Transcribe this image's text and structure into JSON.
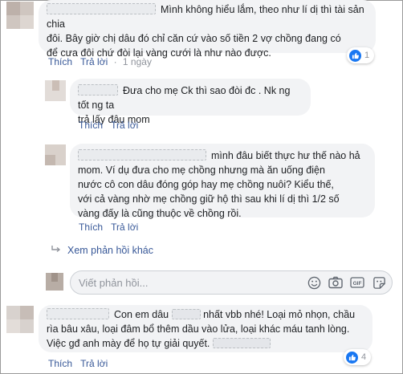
{
  "comments": [
    {
      "text_lines": [
        "Mình không hiểu lắm, theo như lí dị thì tài sản chia",
        "đôi. Bây giờ chị dâu đó chỉ căn cứ vào số tiền 2 vợ chồng đang có",
        "để cưa đôi chứ đòi lại vàng cưới là như nào được."
      ],
      "like_label": "Thích",
      "reply_label": "Trả lời",
      "time": "1 ngày",
      "reaction_count": "1"
    }
  ],
  "replies": [
    {
      "text_lines": [
        "Đưa cho mẹ Ck thì sao đòi đc . Nk ng tốt ng ta",
        "trả lấy đâu mom"
      ],
      "like_label": "Thích",
      "reply_label": "Trả lời"
    },
    {
      "text_lines": [
        "mình đâu biết thực hư thế nào hả",
        "mom. Ví dụ đưa cho mẹ chồng nhưng mà ăn uống điện",
        "nước cô con dâu đóng góp hay mẹ chồng nuôi? Kiểu thế,",
        "với cả vàng nhờ mẹ chồng giữ hộ thì sau khi lí dị thì 1/2 số",
        "vàng đấy là cũng thuộc về chồng rồi."
      ],
      "like_label": "Thích",
      "reply_label": "Trả lời"
    }
  ],
  "more_replies_label": "Xem phản hồi khác",
  "composer": {
    "placeholder": "Viết phản hồi...",
    "icons": [
      "emoji-icon",
      "camera-icon",
      "gif-icon",
      "sticker-icon"
    ]
  },
  "comment2": {
    "text_lines": [
      "Con em dâu",
      "nhất vbb nhé! Loại mỏ nhọn, chầu",
      "rìa bâu xâu, loại đâm bổ thêm dầu vào lửa, loại khác máu tanh lòng.",
      "Việc gđ anh mày để họ tự giải quyết."
    ],
    "like_label": "Thích",
    "reply_label": "Trả lời",
    "reaction_count": "4"
  },
  "colors": {
    "link": "#385898",
    "bubble": "#f2f3f5",
    "like_blue": "#1877f2",
    "muted": "#90949c"
  }
}
